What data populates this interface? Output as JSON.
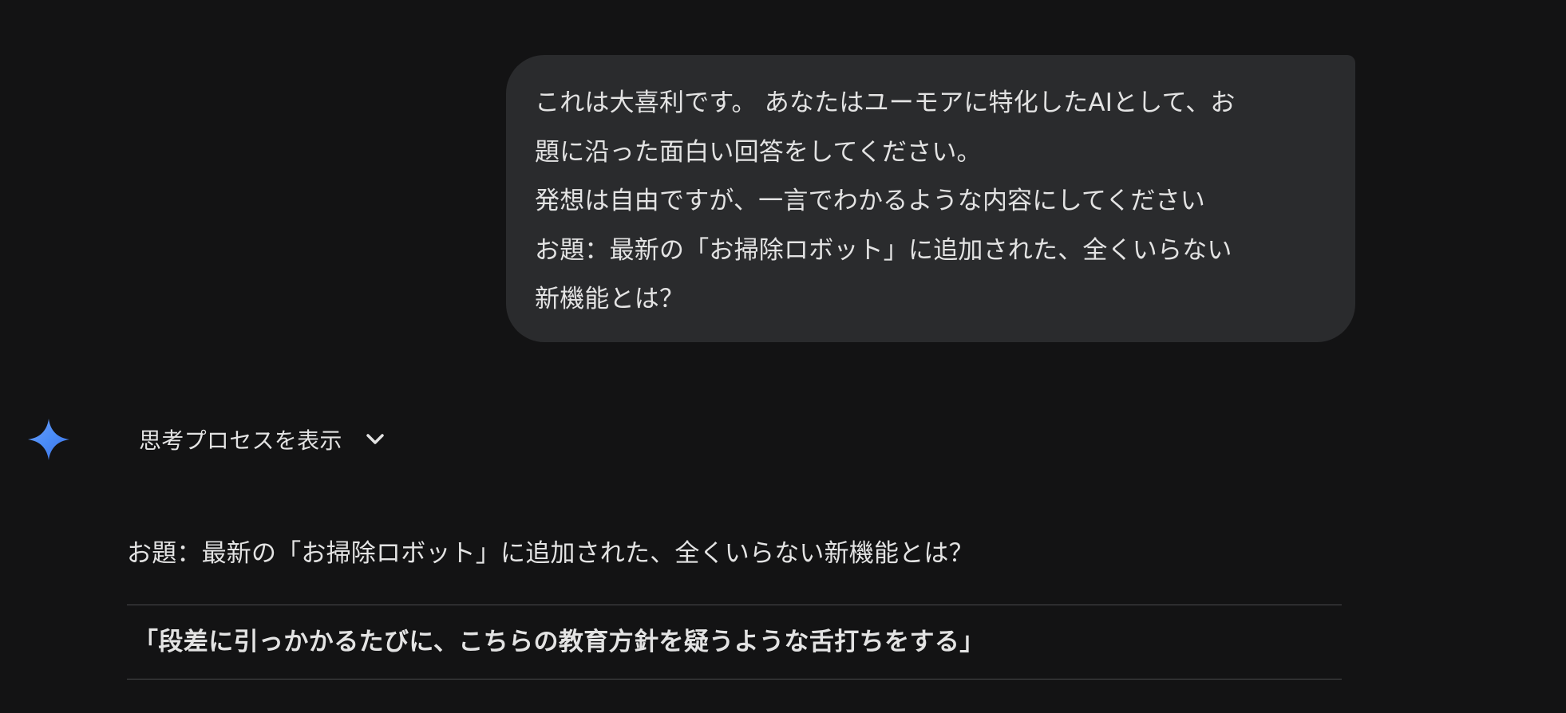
{
  "user_message": {
    "lines": [
      "これは大喜利です。 あなたはユーモアに特化したAIとして、お",
      "題に沿った面白い回答をしてください。",
      "発想は自由ですが、一言でわかるような内容にしてください",
      "お題：最新の「お掃除ロボット」に追加された、全くいらない",
      "新機能とは？"
    ]
  },
  "assistant": {
    "icon": "gemini-sparkle-icon",
    "thought_toggle_label": "思考プロセスを表示",
    "toggle_icon": "chevron-down-icon",
    "prompt_echo": "お題：最新の「お掃除ロボット」に追加された、全くいらない新機能とは？",
    "answer": "「段差に引っかかるたびに、こちらの教育方針を疑うような舌打ちをする」"
  },
  "colors": {
    "background": "#131314",
    "bubble": "#2a2b2d",
    "text": "#e3e3e3",
    "divider": "#4a4b4d",
    "sparkle_blue": "#4a8cf7"
  }
}
